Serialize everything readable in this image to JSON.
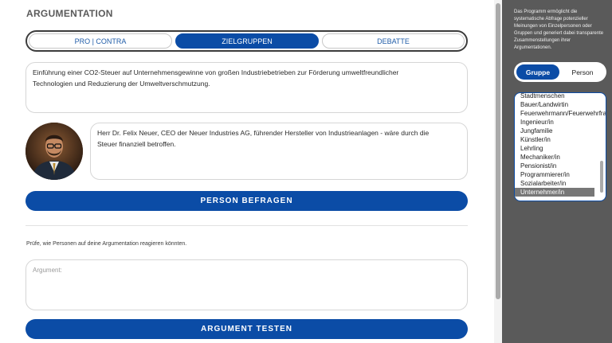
{
  "page": {
    "title": "ARGUMENTATION"
  },
  "tabs": [
    {
      "label": "PRO | CONTRA",
      "active": false
    },
    {
      "label": "ZIELGRUPPEN",
      "active": true
    },
    {
      "label": "DEBATTE",
      "active": false
    }
  ],
  "topic": {
    "line1": "Einführung einer CO2-Steuer auf Unternehmensgewinne von großen Industriebetrieben zur Förderung umweltfreundlicher",
    "line2": "Technologien und Reduzierung der Umweltverschmutzung."
  },
  "person": {
    "line1": "Herr Dr. Felix Neuer, CEO der Neuer Industries AG, führender Hersteller von Industrieanlagen - wäre durch die",
    "line2": "Steuer finanziell betroffen."
  },
  "buttons": {
    "ask_person": "PERSON BEFRAGEN",
    "test_argument": "ARGUMENT TESTEN"
  },
  "hint": "Prüfe, wie Personen auf deine Argumentation reagieren könnten.",
  "argument": {
    "placeholder": "Argument:"
  },
  "sidebar": {
    "description": "Das Programm ermöglicht die systematische Abfrage potenzieller Meinungen von Einzelpersonen oder Gruppen und generiert dabei transparente Zusammenstellungen ihrer Argumentationen.",
    "toggle": {
      "group_label": "Gruppe",
      "person_label": "Person",
      "selected": "Gruppe"
    },
    "list": [
      "Stadtmenschen",
      "Bauer/Landwirtin",
      "Feuerwehrmann/Feuerwehrfrau",
      "Ingenieur/in",
      "Jungfamilie",
      "Künstler/in",
      "Lehrling",
      "Mechaniker/in",
      "Pensionist/in",
      "Programmierer/in",
      "Sozialarbeiter/in",
      "Unternehmer/in"
    ],
    "selected_item": "Unternehmer/in"
  },
  "colors": {
    "accent": "#0b4ca6",
    "sidebar_bg": "#5a5a5a",
    "selected_item_bg": "#777777"
  }
}
